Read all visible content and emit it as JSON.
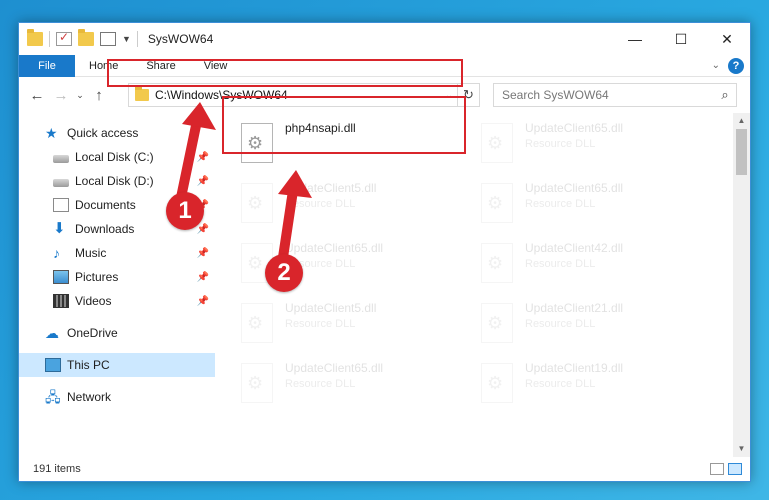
{
  "window": {
    "title": "SysWOW64"
  },
  "ribbon": {
    "file_label": "File",
    "tabs": [
      "Home",
      "Share",
      "View"
    ]
  },
  "address": {
    "path": "C:\\Windows\\SysWOW64",
    "search_placeholder": "Search SysWOW64"
  },
  "nav": {
    "quick_access": "Quick access",
    "items": [
      {
        "label": "Local Disk (C:)",
        "icon": "drive-icon"
      },
      {
        "label": "Local Disk (D:)",
        "icon": "drive-icon"
      },
      {
        "label": "Documents",
        "icon": "documents-icon"
      },
      {
        "label": "Downloads",
        "icon": "downloads-icon"
      },
      {
        "label": "Music",
        "icon": "music-icon"
      },
      {
        "label": "Pictures",
        "icon": "pictures-icon"
      },
      {
        "label": "Videos",
        "icon": "videos-icon"
      }
    ],
    "onedrive": "OneDrive",
    "this_pc": "This PC",
    "network": "Network"
  },
  "files": [
    {
      "name": "php4nsapi.dll",
      "type": ""
    },
    {
      "name": "UpdateClient65.dll",
      "type": "Resource DLL"
    },
    {
      "name": "UpdateClient5.dll",
      "type": "Resource DLL"
    },
    {
      "name": "UpdateClient65.dll",
      "type": "Resource DLL"
    },
    {
      "name": "UpdateClient65.dll",
      "type": "Resource DLL"
    },
    {
      "name": "UpdateClient42.dll",
      "type": "Resource DLL"
    },
    {
      "name": "UpdateClient5.dll",
      "type": "Resource DLL"
    },
    {
      "name": "UpdateClient21.dll",
      "type": "Resource DLL"
    },
    {
      "name": "UpdateClient65.dll",
      "type": "Resource DLL"
    },
    {
      "name": "UpdateClient19.dll",
      "type": "Resource DLL"
    }
  ],
  "status": {
    "items_count": "191 items"
  },
  "annotations": {
    "step1": "1",
    "step2": "2",
    "color": "#d9252b"
  }
}
